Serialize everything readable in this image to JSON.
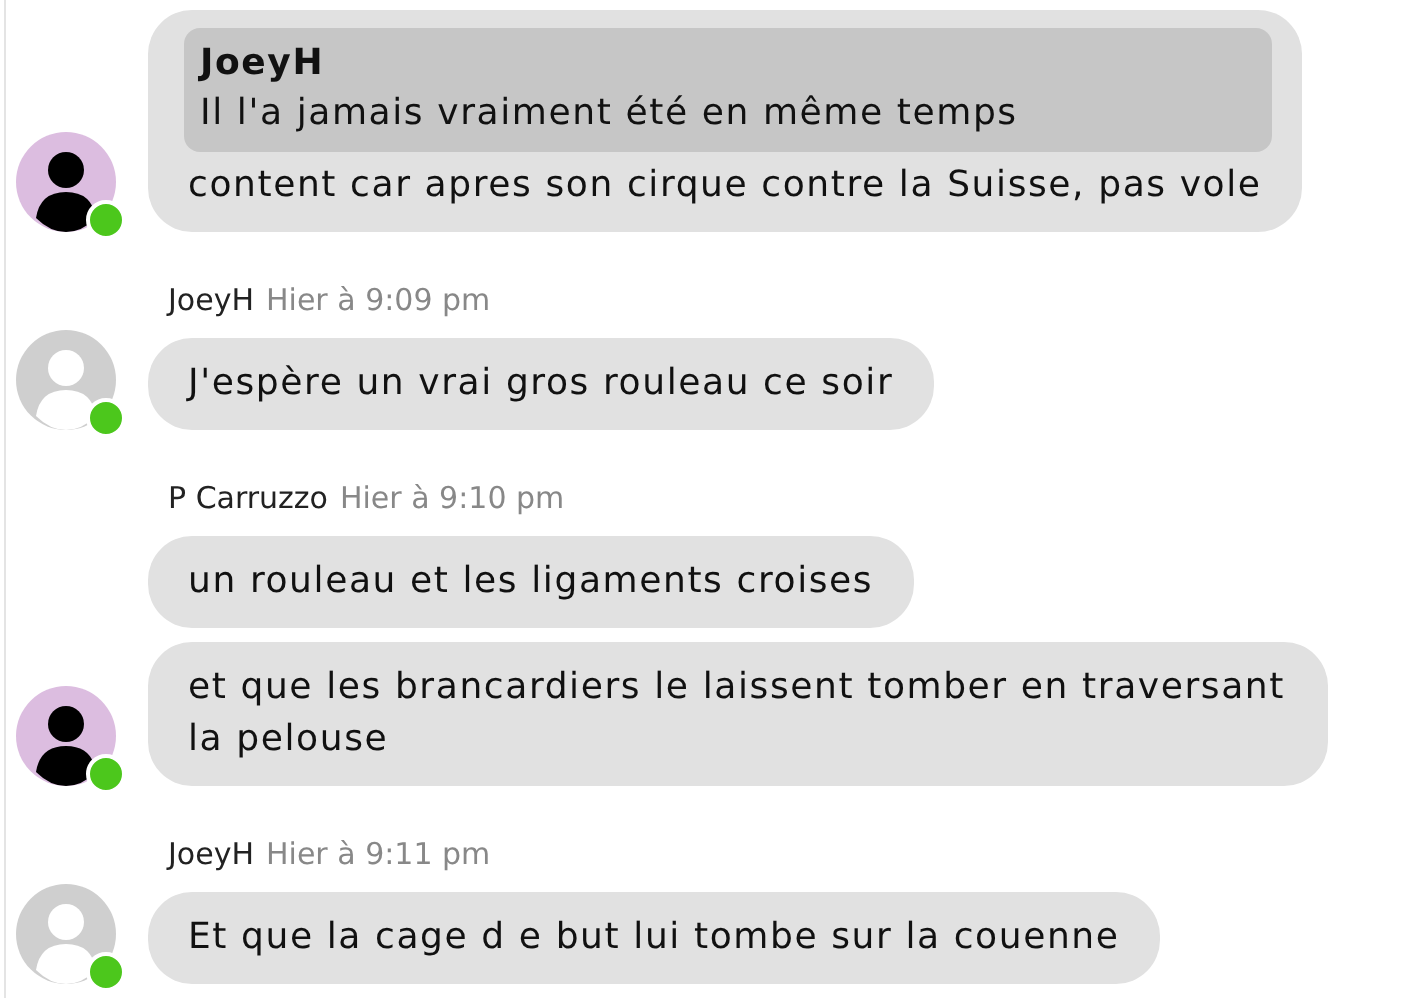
{
  "groups": [
    {
      "kind": "filled",
      "online": true,
      "messages": [
        {
          "quote": {
            "author": "JoeyH",
            "text": "Il l'a jamais vraiment été en même temps"
          },
          "text": "content car apres son cirque contre la Suisse, pas vole"
        }
      ]
    },
    {
      "author": "JoeyH",
      "time": "Hier à 9:09 pm",
      "kind": "blank",
      "online": true,
      "messages": [
        {
          "text": "J'espère un vrai gros rouleau ce soir"
        }
      ]
    },
    {
      "author": "P Carruzzo",
      "time": "Hier à 9:10 pm",
      "kind": "filled",
      "online": true,
      "messages": [
        {
          "text": "un rouleau et les ligaments croises"
        },
        {
          "text": "et que les brancardiers le laissent tomber en traversant la pelouse"
        }
      ]
    },
    {
      "author": "JoeyH",
      "time": "Hier à 9:11 pm",
      "kind": "blank",
      "online": true,
      "messages": [
        {
          "text": "Et que la cage d e but lui tombe sur la couenne"
        }
      ]
    }
  ]
}
